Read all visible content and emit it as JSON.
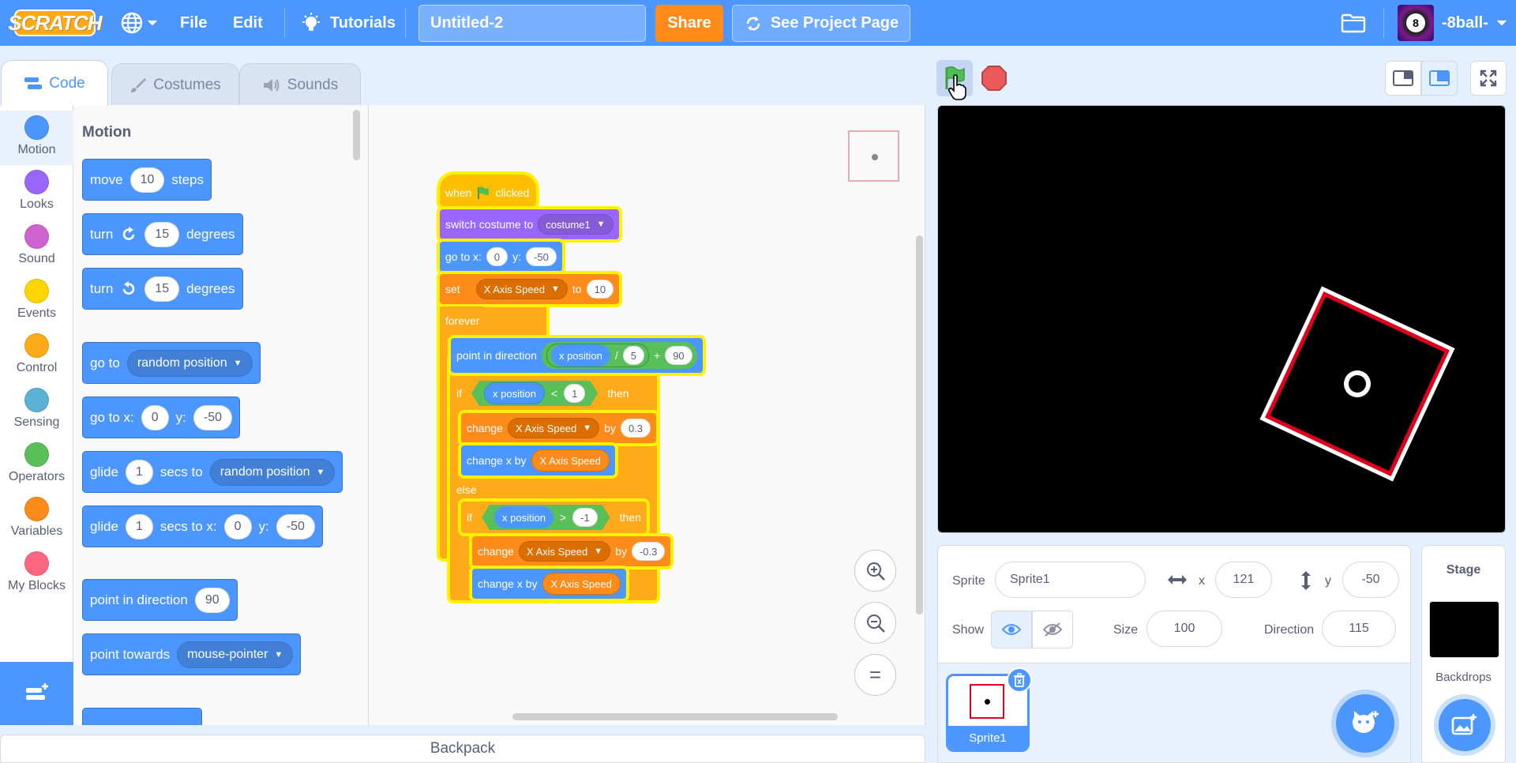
{
  "menubar": {
    "logo_text": "SCRATCH",
    "file_label": "File",
    "edit_label": "Edit",
    "tutorials_label": "Tutorials",
    "project_title": "Untitled-2",
    "share_label": "Share",
    "see_project_label": "See Project Page",
    "username": "-8ball-",
    "avatar_text": "8"
  },
  "tabs": {
    "code": "Code",
    "costumes": "Costumes",
    "sounds": "Sounds"
  },
  "categories": [
    {
      "label": "Motion",
      "color": "#4c97ff"
    },
    {
      "label": "Looks",
      "color": "#9966ff"
    },
    {
      "label": "Sound",
      "color": "#cf63cf"
    },
    {
      "label": "Events",
      "color": "#ffd500"
    },
    {
      "label": "Control",
      "color": "#ffab19"
    },
    {
      "label": "Sensing",
      "color": "#5cb1d6"
    },
    {
      "label": "Operators",
      "color": "#59c059"
    },
    {
      "label": "Variables",
      "color": "#ff8c1a"
    },
    {
      "label": "My Blocks",
      "color": "#ff6680"
    }
  ],
  "palette": {
    "title": "Motion",
    "move": {
      "a": "move",
      "v": "10",
      "b": "steps"
    },
    "turn_cw": {
      "a": "turn",
      "v": "15",
      "b": "degrees"
    },
    "turn_ccw": {
      "a": "turn",
      "v": "15",
      "b": "degrees"
    },
    "goto": {
      "a": "go to",
      "d": "random position"
    },
    "gotoxy": {
      "a": "go to x:",
      "x": "0",
      "b": "y:",
      "y": "-50"
    },
    "glide": {
      "a": "glide",
      "v": "1",
      "b": "secs to",
      "d": "random position"
    },
    "glidexy": {
      "a": "glide",
      "v": "1",
      "b": "secs to x:",
      "x": "0",
      "c": "y:",
      "y": "-50"
    },
    "point_dir": {
      "a": "point in direction",
      "v": "90"
    },
    "point_towards": {
      "a": "point towards",
      "d": "mouse-pointer"
    }
  },
  "script": {
    "hat": {
      "a": "when",
      "b": "clicked"
    },
    "costume": {
      "a": "switch costume to",
      "d": "costume1"
    },
    "gotoxy": {
      "a": "go to x:",
      "x": "0",
      "b": "y:",
      "y": "-50"
    },
    "setvar": {
      "a": "set",
      "d": "X Axis Speed",
      "b": "to",
      "v": "10"
    },
    "forever": "forever",
    "point": {
      "a": "point in direction",
      "r": "x position",
      "op1": "/",
      "n1": "5",
      "op2": "+",
      "n2": "90"
    },
    "if1": {
      "a": "if",
      "r": "x position",
      "op": "<",
      "n": "1",
      "b": "then"
    },
    "change1": {
      "a": "change",
      "d": "X Axis Speed",
      "b": "by",
      "v": "0.3"
    },
    "changex1": {
      "a": "change x by",
      "r": "X Axis Speed"
    },
    "else": "else",
    "if2": {
      "a": "if",
      "r": "x position",
      "op": ">",
      "n": "-1",
      "b": "then"
    },
    "change2": {
      "a": "change",
      "d": "X Axis Speed",
      "b": "by",
      "v": "-0.3"
    },
    "changex2": {
      "a": "change x by",
      "r": "X Axis Speed"
    }
  },
  "zoom": {
    "in": "+",
    "out": "−",
    "reset": "="
  },
  "sprite_info": {
    "sprite_label": "Sprite",
    "sprite_name": "Sprite1",
    "x_label": "x",
    "x_value": "121",
    "y_label": "y",
    "y_value": "-50",
    "show_label": "Show",
    "size_label": "Size",
    "size_value": "100",
    "direction_label": "Direction",
    "direction_value": "115"
  },
  "sprites": [
    {
      "name": "Sprite1"
    }
  ],
  "stage_panel": {
    "title": "Stage",
    "backdrops_label": "Backdrops"
  },
  "backpack_label": "Backpack",
  "colors": {
    "accent": "#4c97ff",
    "stage_bg": "#000000",
    "sprite_border": "#e0001b"
  }
}
